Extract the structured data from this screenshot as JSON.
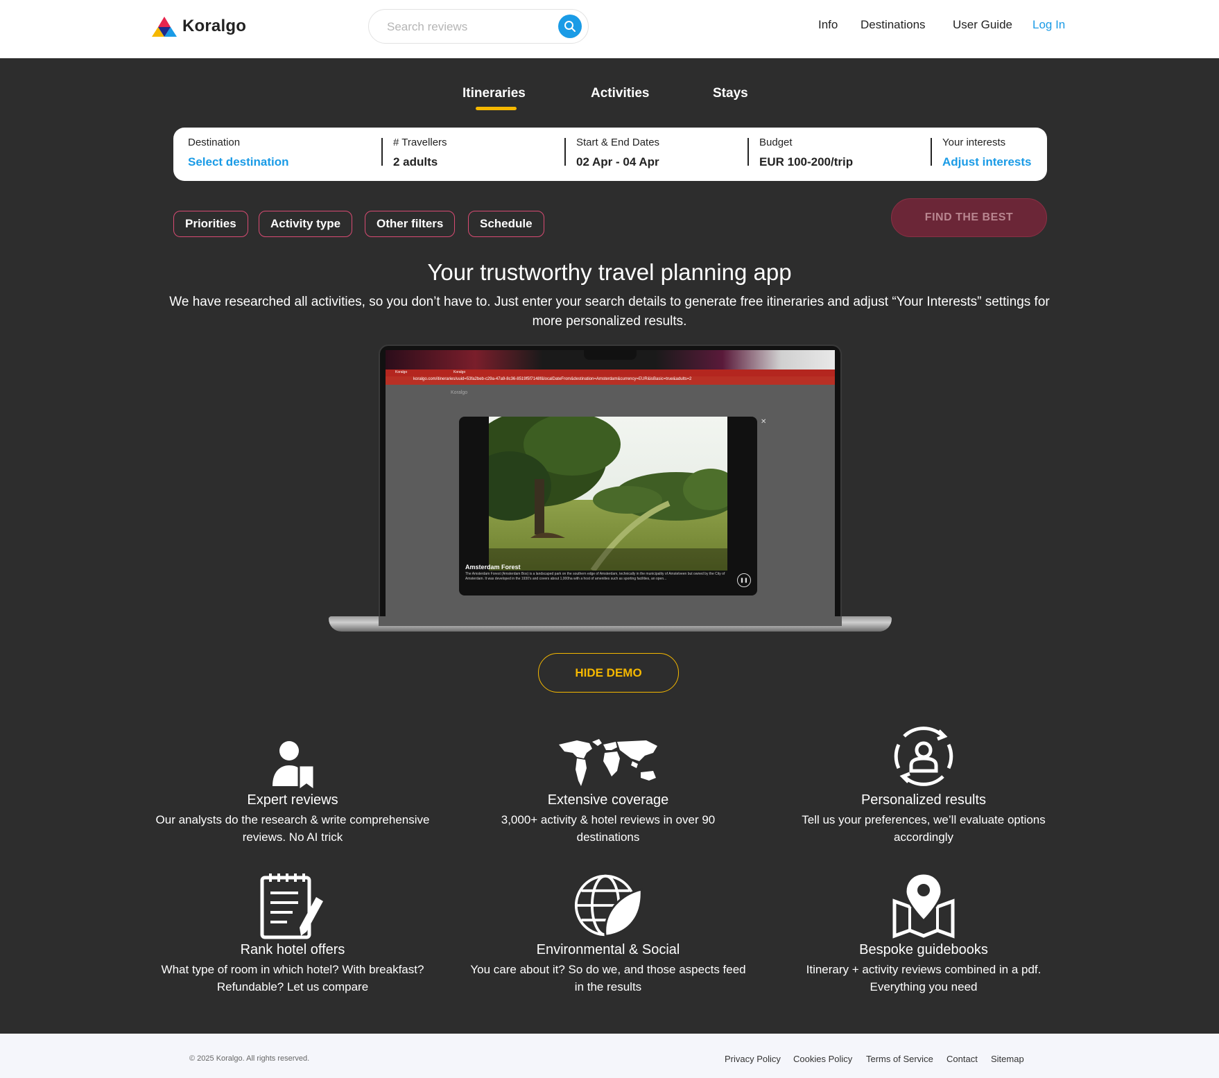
{
  "header": {
    "logo_text": "Koralgo",
    "search_placeholder": "Search reviews",
    "nav": [
      "Info",
      "Destinations",
      "User Guide"
    ],
    "login": "Log In"
  },
  "tabs": [
    "Itineraries",
    "Activities",
    "Stays"
  ],
  "active_tab": "Itineraries",
  "search_panel": {
    "destination": {
      "label": "Destination",
      "value": "Select destination"
    },
    "travellers": {
      "label": "# Travellers",
      "value": "2 adults"
    },
    "dates": {
      "label": "Start & End Dates",
      "value": "02 Apr - 04 Apr"
    },
    "budget": {
      "label": "Budget",
      "value": "EUR 100-200/trip"
    },
    "interests": {
      "label": "Your interests",
      "value": "Adjust interests"
    }
  },
  "filters": [
    "Priorities",
    "Activity type",
    "Other filters",
    "Schedule"
  ],
  "find_button": "FIND THE BEST",
  "hero": {
    "title": "Your trustworthy travel planning app",
    "subtitle": "We have researched all activities, so you don’t have to. Just enter your search details to generate free itineraries and adjust “Your Interests” settings for more personalized results."
  },
  "demo": {
    "browser_tab_1": "Koralgo",
    "browser_tab_2": "Koralgo",
    "url": "koralgo.com/itineraries/uuid=53fa2beb-c29a-47a9-8c36-8519f5f7148f&localDateFrom&destination=Amsterdam&currency=EUR&isBasic=true&adults=2",
    "page_logo": "Koralgo",
    "modal_title": "Amsterdam Forest",
    "modal_desc": "The Amsterdam Forest (Amsterdam Bos) is a landscaped park on the southern edge of Amsterdam, technically in the municipality of Amstelveen but owned by the City of Amsterdam. It was developed in the 1930's and covers about 1,000ha with a host of amenities such as sporting facilities, an open...",
    "hide_button": "HIDE DEMO"
  },
  "features": [
    {
      "icon": "expert-reviewer-icon",
      "title": "Expert reviews",
      "desc": "Our analysts do the research & write comprehensive reviews. No AI trick"
    },
    {
      "icon": "world-map-icon",
      "title": "Extensive coverage",
      "desc": "3,000+ activity & hotel reviews in over 90 destinations"
    },
    {
      "icon": "personalized-user-cycle-icon",
      "title": "Personalized results",
      "desc": "Tell us your preferences, we’ll evaluate options accordingly"
    },
    {
      "icon": "notepad-pencil-icon",
      "title": "Rank hotel offers",
      "desc": "What type of room in which hotel? With breakfast? Refundable? Let us compare"
    },
    {
      "icon": "globe-leaf-icon",
      "title": "Environmental & Social",
      "desc": "You care about it? So do we, and those aspects feed in the results"
    },
    {
      "icon": "map-pin-icon",
      "title": "Bespoke guidebooks",
      "desc": "Itinerary + activity reviews combined in a pdf. Everything you need"
    }
  ],
  "footer": {
    "copyright": "© 2025 Koralgo. All rights reserved.",
    "links": [
      "Privacy Policy",
      "Cookies Policy",
      "Terms of Service",
      "Contact",
      "Sitemap"
    ]
  },
  "colors": {
    "accent_blue": "#1a9be6",
    "accent_yellow": "#f5b800",
    "chip_border": "#d94b73",
    "find_button_bg": "#6b2637",
    "background": "#2d2d2d"
  }
}
